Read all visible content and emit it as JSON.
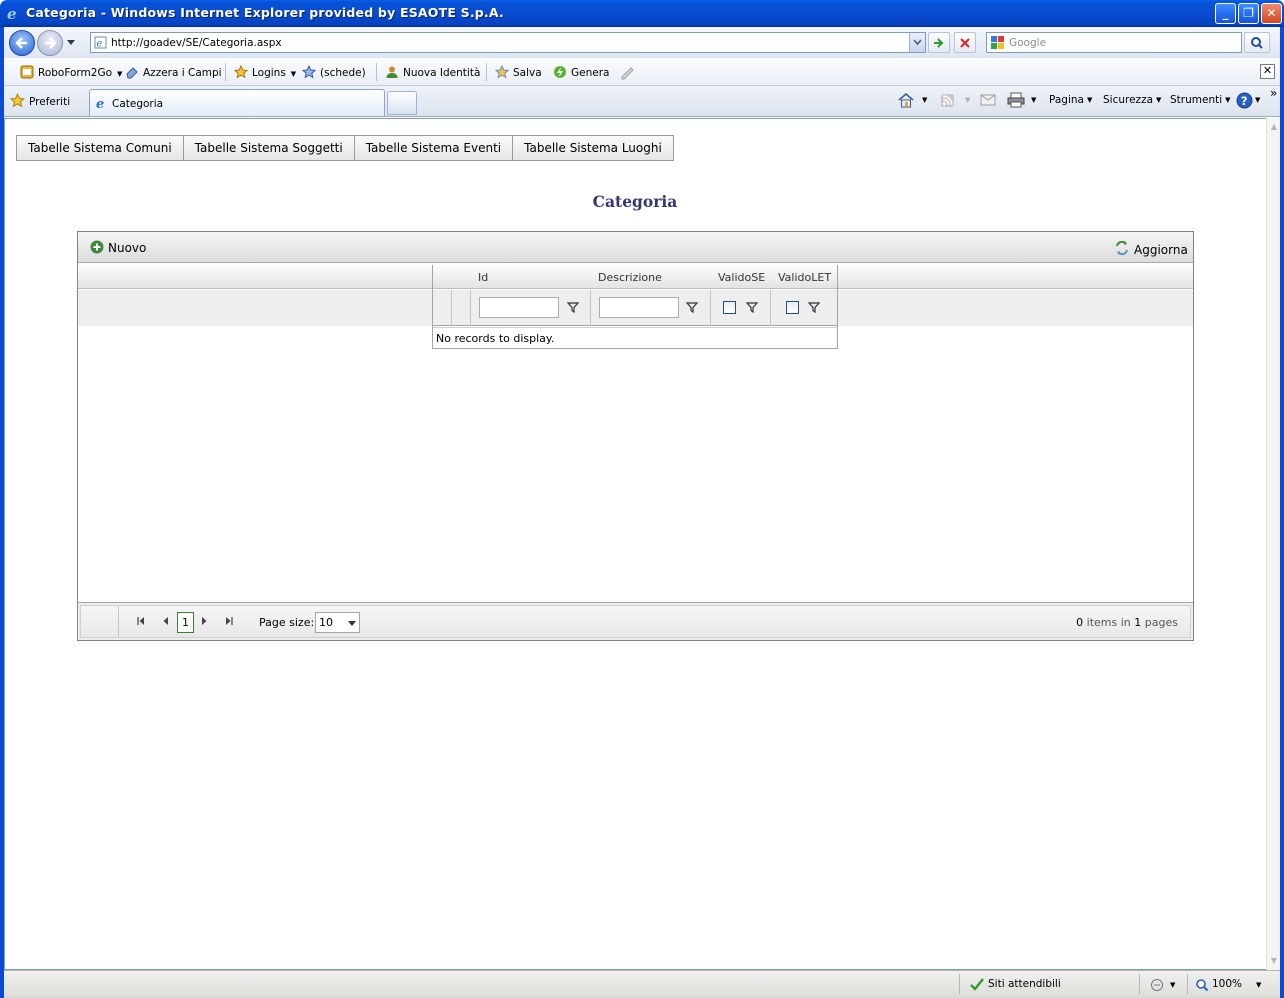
{
  "window": {
    "title": "Categoria - Windows Internet Explorer provided by ESAOTE S.p.A.",
    "minimize": "_",
    "maximize": "❐",
    "close": "✕"
  },
  "navbar": {
    "url": "http://goadev/SE/Categoria.aspx",
    "search_placeholder": "Google"
  },
  "linksbar": {
    "items": [
      "RoboForm2Go",
      "Azzera i Campi",
      "Logins",
      "(schede)",
      "Nuova Identità",
      "Salva",
      "Genera"
    ]
  },
  "tabsbar": {
    "favorites": "Preferiti",
    "tab_title": "Categoria",
    "commands": [
      "Pagina",
      "Sicurezza",
      "Strumenti"
    ]
  },
  "page": {
    "nav": [
      "Tabelle Sistema Comuni",
      "Tabelle Sistema Soggetti",
      "Tabelle Sistema Eventi",
      "Tabelle Sistema Luoghi"
    ],
    "title": "Categoria"
  },
  "grid": {
    "new_label": "Nuovo",
    "refresh_label": "Aggiorna",
    "columns": [
      "Id",
      "Descrizione",
      "ValidoSE",
      "ValidoLET"
    ],
    "empty_message": "No records to display.",
    "pager": {
      "current_page": "1",
      "page_size_label": "Page size:",
      "page_size": "10",
      "item_count": "0",
      "items_in": "items in",
      "page_count": "1",
      "pages": "pages"
    }
  },
  "statusbar": {
    "zone": "Siti attendibili",
    "zoom": "100%"
  },
  "colors": {
    "title_bar": "#0553d6",
    "page_title": "#363670",
    "pager_current_border": "#3c7f2f"
  }
}
